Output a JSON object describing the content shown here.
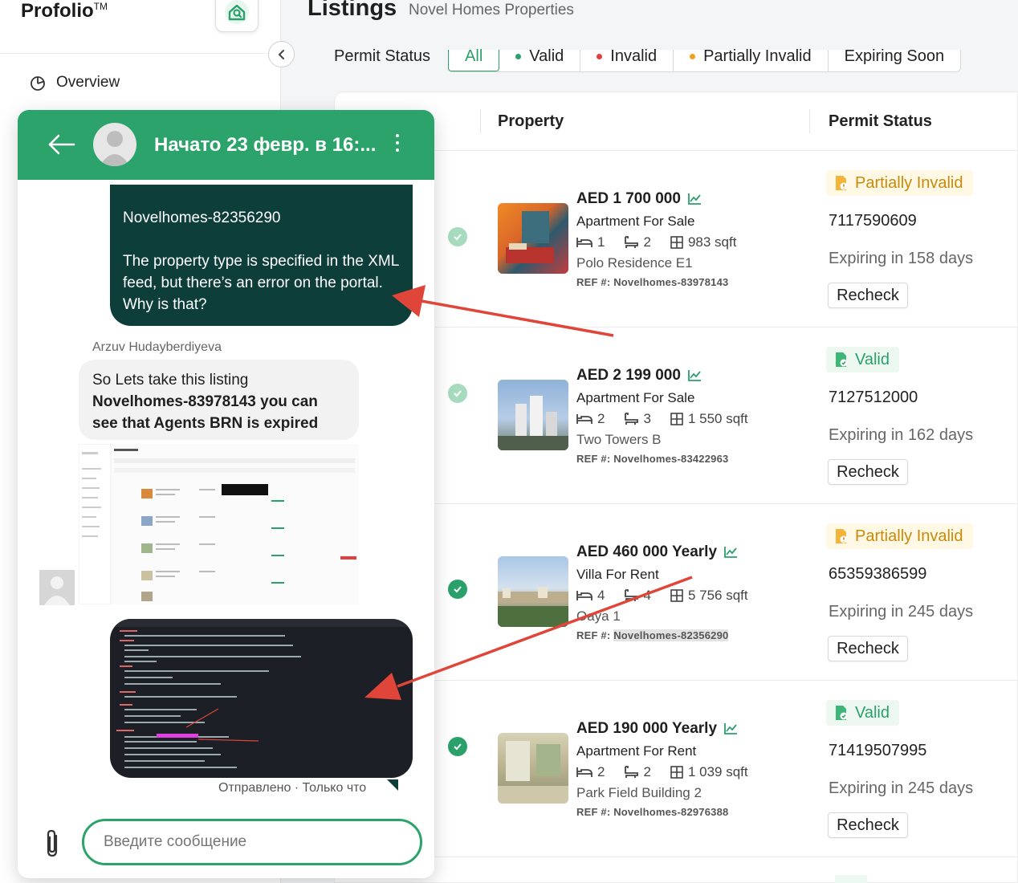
{
  "brand": {
    "name": "Profolio",
    "tm": "TM"
  },
  "sidebar": {
    "overview_label": "Overview"
  },
  "header": {
    "title": "Listings",
    "subtitle": "Novel Homes Properties"
  },
  "filters": {
    "label": "Permit Status",
    "tabs": [
      {
        "label": "All",
        "dot": ""
      },
      {
        "label": "Valid",
        "dot": "#2aa06a"
      },
      {
        "label": "Invalid",
        "dot": "#e04040"
      },
      {
        "label": "Partially Invalid",
        "dot": "#f0a020"
      },
      {
        "label": "Expiring Soon",
        "dot": ""
      }
    ]
  },
  "table": {
    "headers": {
      "property": "Property",
      "permit_status": "Permit Status"
    },
    "rows": [
      {
        "price": "AED 1 700 000",
        "type": "Apartment For Sale",
        "beds": "1",
        "baths": "2",
        "area": "983 sqft",
        "building": "Polo Residence E1",
        "ref_label": "REF #:",
        "ref": "Novelhomes-83978143",
        "status": "Partially Invalid",
        "permit": "7117590609",
        "expiring": "Expiring in 158 days",
        "recheck": "Recheck"
      },
      {
        "price": "AED 2 199 000",
        "type": "Apartment For Sale",
        "beds": "2",
        "baths": "3",
        "area": "1 550 sqft",
        "building": "Two Towers B",
        "ref_label": "REF #:",
        "ref": "Novelhomes-83422963",
        "status": "Valid",
        "permit": "7127512000",
        "expiring": "Expiring in 162 days",
        "recheck": "Recheck"
      },
      {
        "price": "AED 460 000 Yearly",
        "type": "Villa For Rent",
        "beds": "4",
        "baths": "4",
        "area": "5 756 sqft",
        "building": "Oaya 1",
        "ref_label": "REF #:",
        "ref": "Novelhomes-82356290",
        "status": "Partially Invalid",
        "permit": "65359386599",
        "expiring": "Expiring in 245 days",
        "recheck": "Recheck"
      },
      {
        "price": "AED 190 000 Yearly",
        "type": "Apartment For Rent",
        "beds": "2",
        "baths": "2",
        "area": "1 039 sqft",
        "building": "Park Field Building 2",
        "ref_label": "REF #:",
        "ref": "Novelhomes-82976388",
        "status": "Valid",
        "permit": "71419507995",
        "expiring": "Expiring in 245 days",
        "recheck": "Recheck"
      }
    ]
  },
  "chat": {
    "title": "Начато 23 февр. в 16:...",
    "outgoing": {
      "ref": "Novelhomes-82356290",
      "text": "The property type is specified in the XML feed, but there’s an error on the portal. Why is that?"
    },
    "agent_name": "Arzuv Hudayberdiyeva",
    "incoming": {
      "prefix": "So Lets take this listing",
      "bold": "Novelhomes-83978143 you can see that Agents BRN is expired"
    },
    "sent_meta": "Отправлено · Только что",
    "input_placeholder": "Введите сообщение"
  },
  "colors": {
    "brand_green": "#2ba36b",
    "dark_bubble": "#0d3e3a",
    "valid": "#2aa06a",
    "partial": "#c98a0a",
    "arrow_red": "#e0453a"
  }
}
